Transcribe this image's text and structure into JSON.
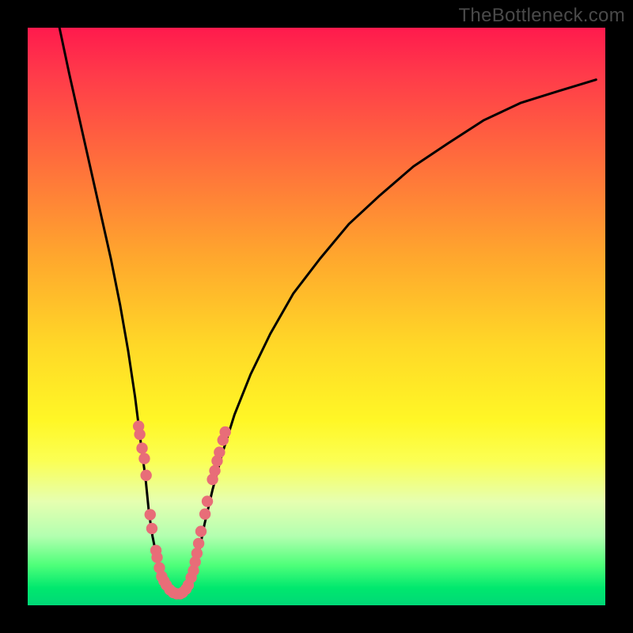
{
  "watermark": "TheBottleneck.com",
  "chart_data": {
    "type": "line",
    "title": "",
    "xlabel": "",
    "ylabel": "",
    "xlim": [
      0,
      1
    ],
    "ylim": [
      0,
      1
    ],
    "left_curve": {
      "name": "left-branch",
      "points": [
        [
          0.055,
          1.0
        ],
        [
          0.072,
          0.92
        ],
        [
          0.09,
          0.84
        ],
        [
          0.108,
          0.76
        ],
        [
          0.126,
          0.68
        ],
        [
          0.144,
          0.6
        ],
        [
          0.16,
          0.52
        ],
        [
          0.174,
          0.44
        ],
        [
          0.186,
          0.36
        ],
        [
          0.196,
          0.28
        ],
        [
          0.204,
          0.22
        ],
        [
          0.21,
          0.16
        ],
        [
          0.216,
          0.12
        ],
        [
          0.224,
          0.08
        ],
        [
          0.232,
          0.05
        ],
        [
          0.242,
          0.03
        ],
        [
          0.252,
          0.02
        ],
        [
          0.262,
          0.02
        ]
      ]
    },
    "right_curve": {
      "name": "right-branch",
      "points": [
        [
          0.262,
          0.02
        ],
        [
          0.272,
          0.02
        ],
        [
          0.282,
          0.04
        ],
        [
          0.294,
          0.08
        ],
        [
          0.306,
          0.14
        ],
        [
          0.32,
          0.2
        ],
        [
          0.336,
          0.26
        ],
        [
          0.358,
          0.33
        ],
        [
          0.386,
          0.4
        ],
        [
          0.42,
          0.47
        ],
        [
          0.46,
          0.54
        ],
        [
          0.506,
          0.6
        ],
        [
          0.556,
          0.66
        ],
        [
          0.61,
          0.71
        ],
        [
          0.668,
          0.76
        ],
        [
          0.728,
          0.8
        ],
        [
          0.79,
          0.84
        ],
        [
          0.854,
          0.87
        ],
        [
          0.918,
          0.89
        ],
        [
          0.984,
          0.91
        ]
      ]
    },
    "markers_left": [
      [
        0.192,
        0.31
      ],
      [
        0.194,
        0.296
      ],
      [
        0.198,
        0.272
      ],
      [
        0.202,
        0.254
      ],
      [
        0.205,
        0.225
      ],
      [
        0.212,
        0.157
      ],
      [
        0.215,
        0.133
      ],
      [
        0.222,
        0.095
      ],
      [
        0.224,
        0.083
      ],
      [
        0.228,
        0.065
      ],
      [
        0.232,
        0.05
      ],
      [
        0.236,
        0.042
      ],
      [
        0.24,
        0.035
      ],
      [
        0.246,
        0.027
      ],
      [
        0.252,
        0.022
      ],
      [
        0.258,
        0.02
      ]
    ],
    "markers_right": [
      [
        0.264,
        0.02
      ],
      [
        0.268,
        0.022
      ],
      [
        0.274,
        0.028
      ],
      [
        0.278,
        0.035
      ],
      [
        0.283,
        0.048
      ],
      [
        0.287,
        0.06
      ],
      [
        0.29,
        0.075
      ],
      [
        0.293,
        0.09
      ],
      [
        0.296,
        0.107
      ],
      [
        0.3,
        0.128
      ],
      [
        0.307,
        0.158
      ],
      [
        0.311,
        0.18
      ],
      [
        0.32,
        0.218
      ],
      [
        0.324,
        0.233
      ],
      [
        0.328,
        0.25
      ],
      [
        0.332,
        0.265
      ],
      [
        0.338,
        0.286
      ],
      [
        0.342,
        0.3
      ]
    ],
    "marker_color": "#e86d78",
    "curve_color": "#000000"
  }
}
